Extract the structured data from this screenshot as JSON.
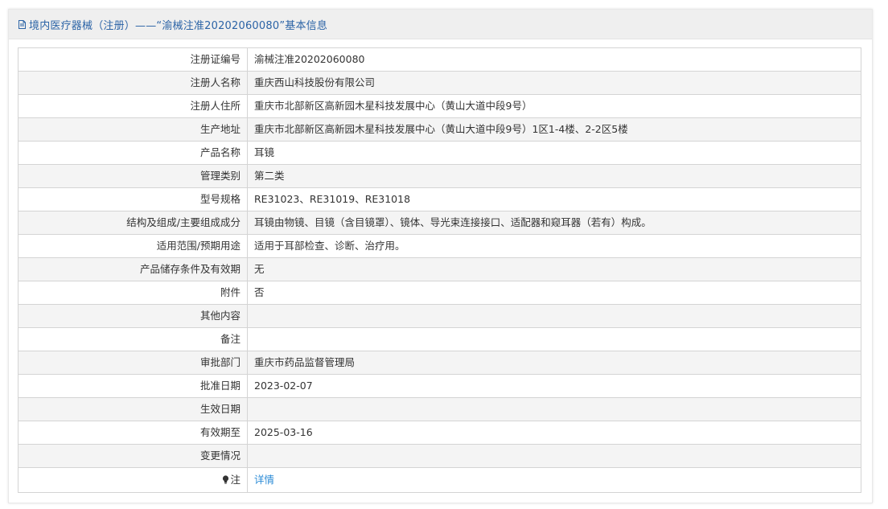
{
  "header": {
    "icon": "document-icon",
    "title": "境内医疗器械（注册）——“渝械注准20202060080”基本信息"
  },
  "rows": [
    {
      "label": "注册证编号",
      "value": "渝械注准20202060080"
    },
    {
      "label": "注册人名称",
      "value": "重庆西山科技股份有限公司"
    },
    {
      "label": "注册人住所",
      "value": "重庆市北部新区高新园木星科技发展中心（黄山大道中段9号）"
    },
    {
      "label": "生产地址",
      "value": "重庆市北部新区高新园木星科技发展中心（黄山大道中段9号）1区1-4楼、2-2区5楼"
    },
    {
      "label": "产品名称",
      "value": "耳镜"
    },
    {
      "label": "管理类别",
      "value": "第二类"
    },
    {
      "label": "型号规格",
      "value": "RE31023、RE31019、RE31018"
    },
    {
      "label": "结构及组成/主要组成成分",
      "value": "耳镜由物镜、目镜（含目镜罩）、镜体、导光束连接接口、适配器和窥耳器（若有）构成。"
    },
    {
      "label": "适用范围/预期用途",
      "value": "适用于耳部检查、诊断、治疗用。"
    },
    {
      "label": "产品储存条件及有效期",
      "value": "无"
    },
    {
      "label": "附件",
      "value": "否"
    },
    {
      "label": "其他内容",
      "value": ""
    },
    {
      "label": "备注",
      "value": ""
    },
    {
      "label": "审批部门",
      "value": "重庆市药品监督管理局"
    },
    {
      "label": "批准日期",
      "value": "2023-02-07"
    },
    {
      "label": "生效日期",
      "value": ""
    },
    {
      "label": "有效期至",
      "value": "2025-03-16"
    },
    {
      "label": "变更情况",
      "value": ""
    }
  ],
  "note_row": {
    "icon": "lightbulb-icon",
    "label": "注",
    "link": "详情"
  },
  "colors": {
    "header_text": "#2b63a6",
    "link": "#2b8bd6"
  }
}
